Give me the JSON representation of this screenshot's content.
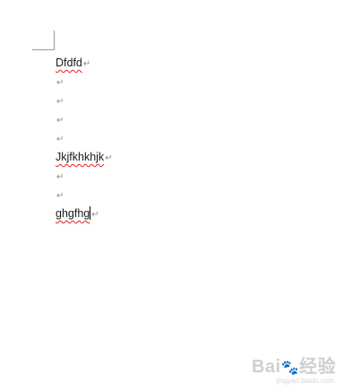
{
  "document": {
    "lines": [
      {
        "text": "Dfdfd",
        "spell_error": true,
        "mark": "↵"
      },
      {
        "text": "",
        "spell_error": false,
        "mark": "↵"
      },
      {
        "text": "",
        "spell_error": false,
        "mark": "↵"
      },
      {
        "text": "",
        "spell_error": false,
        "mark": "↵"
      },
      {
        "text": "",
        "spell_error": false,
        "mark": "↵"
      },
      {
        "text": "Jkjfkhkhjk",
        "spell_error": true,
        "mark": "↵"
      },
      {
        "text": "",
        "spell_error": false,
        "mark": "↵"
      },
      {
        "text": "",
        "spell_error": false,
        "mark": "↵"
      },
      {
        "text": "ghgfhg",
        "spell_error": true,
        "mark": "↵",
        "caret": true
      }
    ]
  },
  "watermark": {
    "brand": "Bai",
    "paw": "🐾",
    "suffix": "经验",
    "sub": "jingyan.baidu.com"
  },
  "colors": {
    "spell_underline": "#e02020",
    "para_mark": "#8a8a8a",
    "text": "#1a1a1a"
  }
}
